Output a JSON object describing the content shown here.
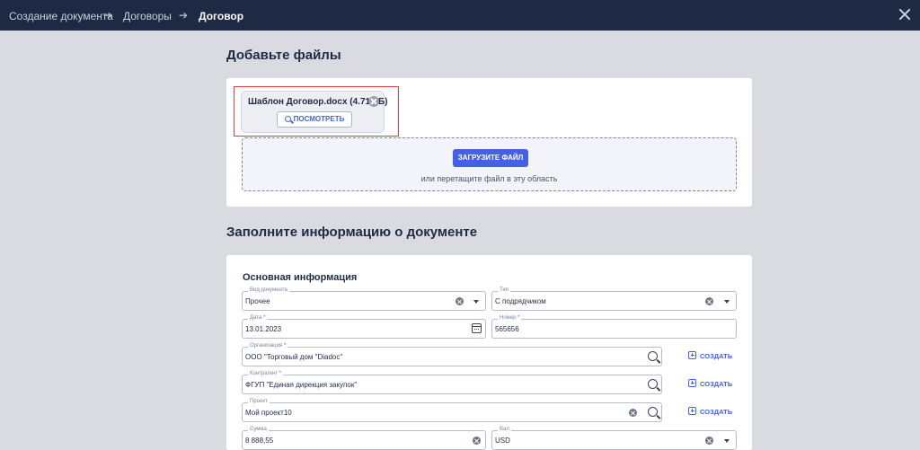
{
  "breadcrumbs": [
    {
      "label": "Создание документа"
    },
    {
      "label": "Договоры"
    },
    {
      "label": "Договор"
    }
  ],
  "breadcrumb_separator": "➔",
  "files_section": {
    "title": "Добавьте файлы",
    "file": {
      "name": "Шаблон Договор.docx (4.71 КБ)",
      "view_label": "ПОСМОТРЕТЬ"
    },
    "upload_label": "ЗАГРУЗИТЕ ФАЙЛ",
    "drop_hint": "или перетащите файл в эту область"
  },
  "info_section": {
    "title": "Заполните информацию о документе",
    "subtitle": "Основная информация",
    "create_label": "СОЗДАТЬ",
    "fields": {
      "doc_type": {
        "label": "Вид документа",
        "value": "Прочее"
      },
      "type": {
        "label": "Тип",
        "value": "С подрядчиком"
      },
      "date": {
        "label": "Дата",
        "value": "13.01.2023"
      },
      "number": {
        "label": "Номер",
        "value": "565656"
      },
      "organization": {
        "label": "Организация",
        "value": "ООО \"Торговый дом \"Diadoc\""
      },
      "counterparty": {
        "label": "Контрагент",
        "value": "ФГУП \"Единая дирекция закупок\""
      },
      "project": {
        "label": "Проект",
        "value": "Мой проект10"
      },
      "amount": {
        "label": "Сумма",
        "value": "8 888,55"
      },
      "currency": {
        "label": "Вал",
        "value": "USD"
      }
    }
  },
  "colors": {
    "topbar": "#1e2a44",
    "accent": "#4460e6",
    "highlight_box": "#e23b3b",
    "background": "#d9dbe1"
  }
}
